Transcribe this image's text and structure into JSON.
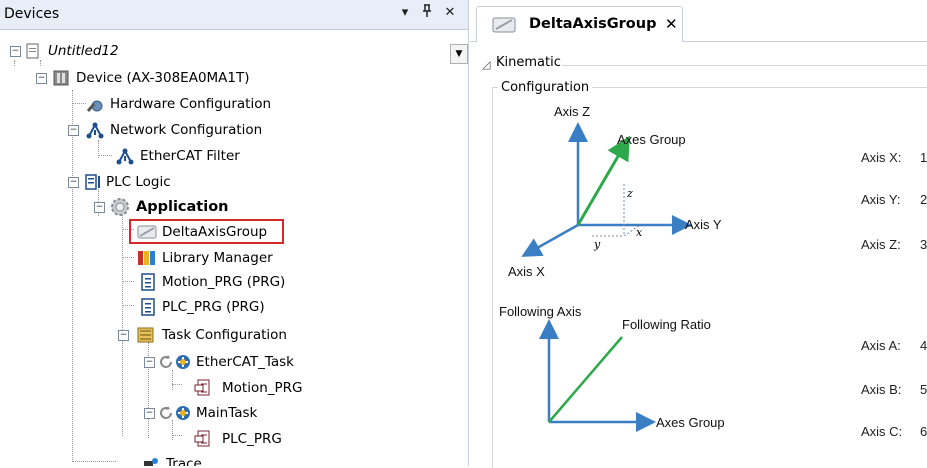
{
  "devices_panel": {
    "title": "Devices",
    "buttons": {
      "menu": "▾",
      "pin": "ᵖ",
      "close": "✕"
    }
  },
  "tree": {
    "project": "Untitled12",
    "device": "Device (AX-308EA0MA1T)",
    "hardware_configuration": "Hardware Configuration",
    "network_configuration": "Network Configuration",
    "ethercat_filter": "EtherCAT Filter",
    "plc_logic": "PLC Logic",
    "application": "Application",
    "delta_axis_group": "DeltaAxisGroup",
    "library_manager": "Library Manager",
    "motion_prg": "Motion_PRG (PRG)",
    "plc_prg": "PLC_PRG (PRG)",
    "task_configuration": "Task Configuration",
    "ethercat_task": "EtherCAT_Task",
    "motion_prg_call": "Motion_PRG",
    "main_task": "MainTask",
    "plc_prg_call": "PLC_PRG",
    "trace": "Trace"
  },
  "editor": {
    "tab_title": "DeltaAxisGroup",
    "tab_close": "✕",
    "kinematic_label": "Kinematic",
    "configuration_label": "Configuration",
    "diagram1": {
      "axis_z": "Axis Z",
      "axes_group": "Axes Group",
      "axis_y": "Axis Y",
      "axis_x": "Axis X",
      "z": "z",
      "x": "x",
      "y": "y"
    },
    "diagram2": {
      "following_axis": "Following Axis",
      "following_ratio": "Following Ratio",
      "axes_group": "Axes Group"
    },
    "fields": [
      {
        "label": "Axis X:",
        "value": "1"
      },
      {
        "label": "Axis Y:",
        "value": "2"
      },
      {
        "label": "Axis Z:",
        "value": "3"
      },
      {
        "label": "Axis A:",
        "value": "4"
      },
      {
        "label": "Axis B:",
        "value": "5"
      },
      {
        "label": "Axis C:",
        "value": "6"
      }
    ]
  },
  "colors": {
    "selection_box": "#d62a2a",
    "arrow_blue": "#3a7fc4",
    "arrow_green": "#2da84a"
  }
}
